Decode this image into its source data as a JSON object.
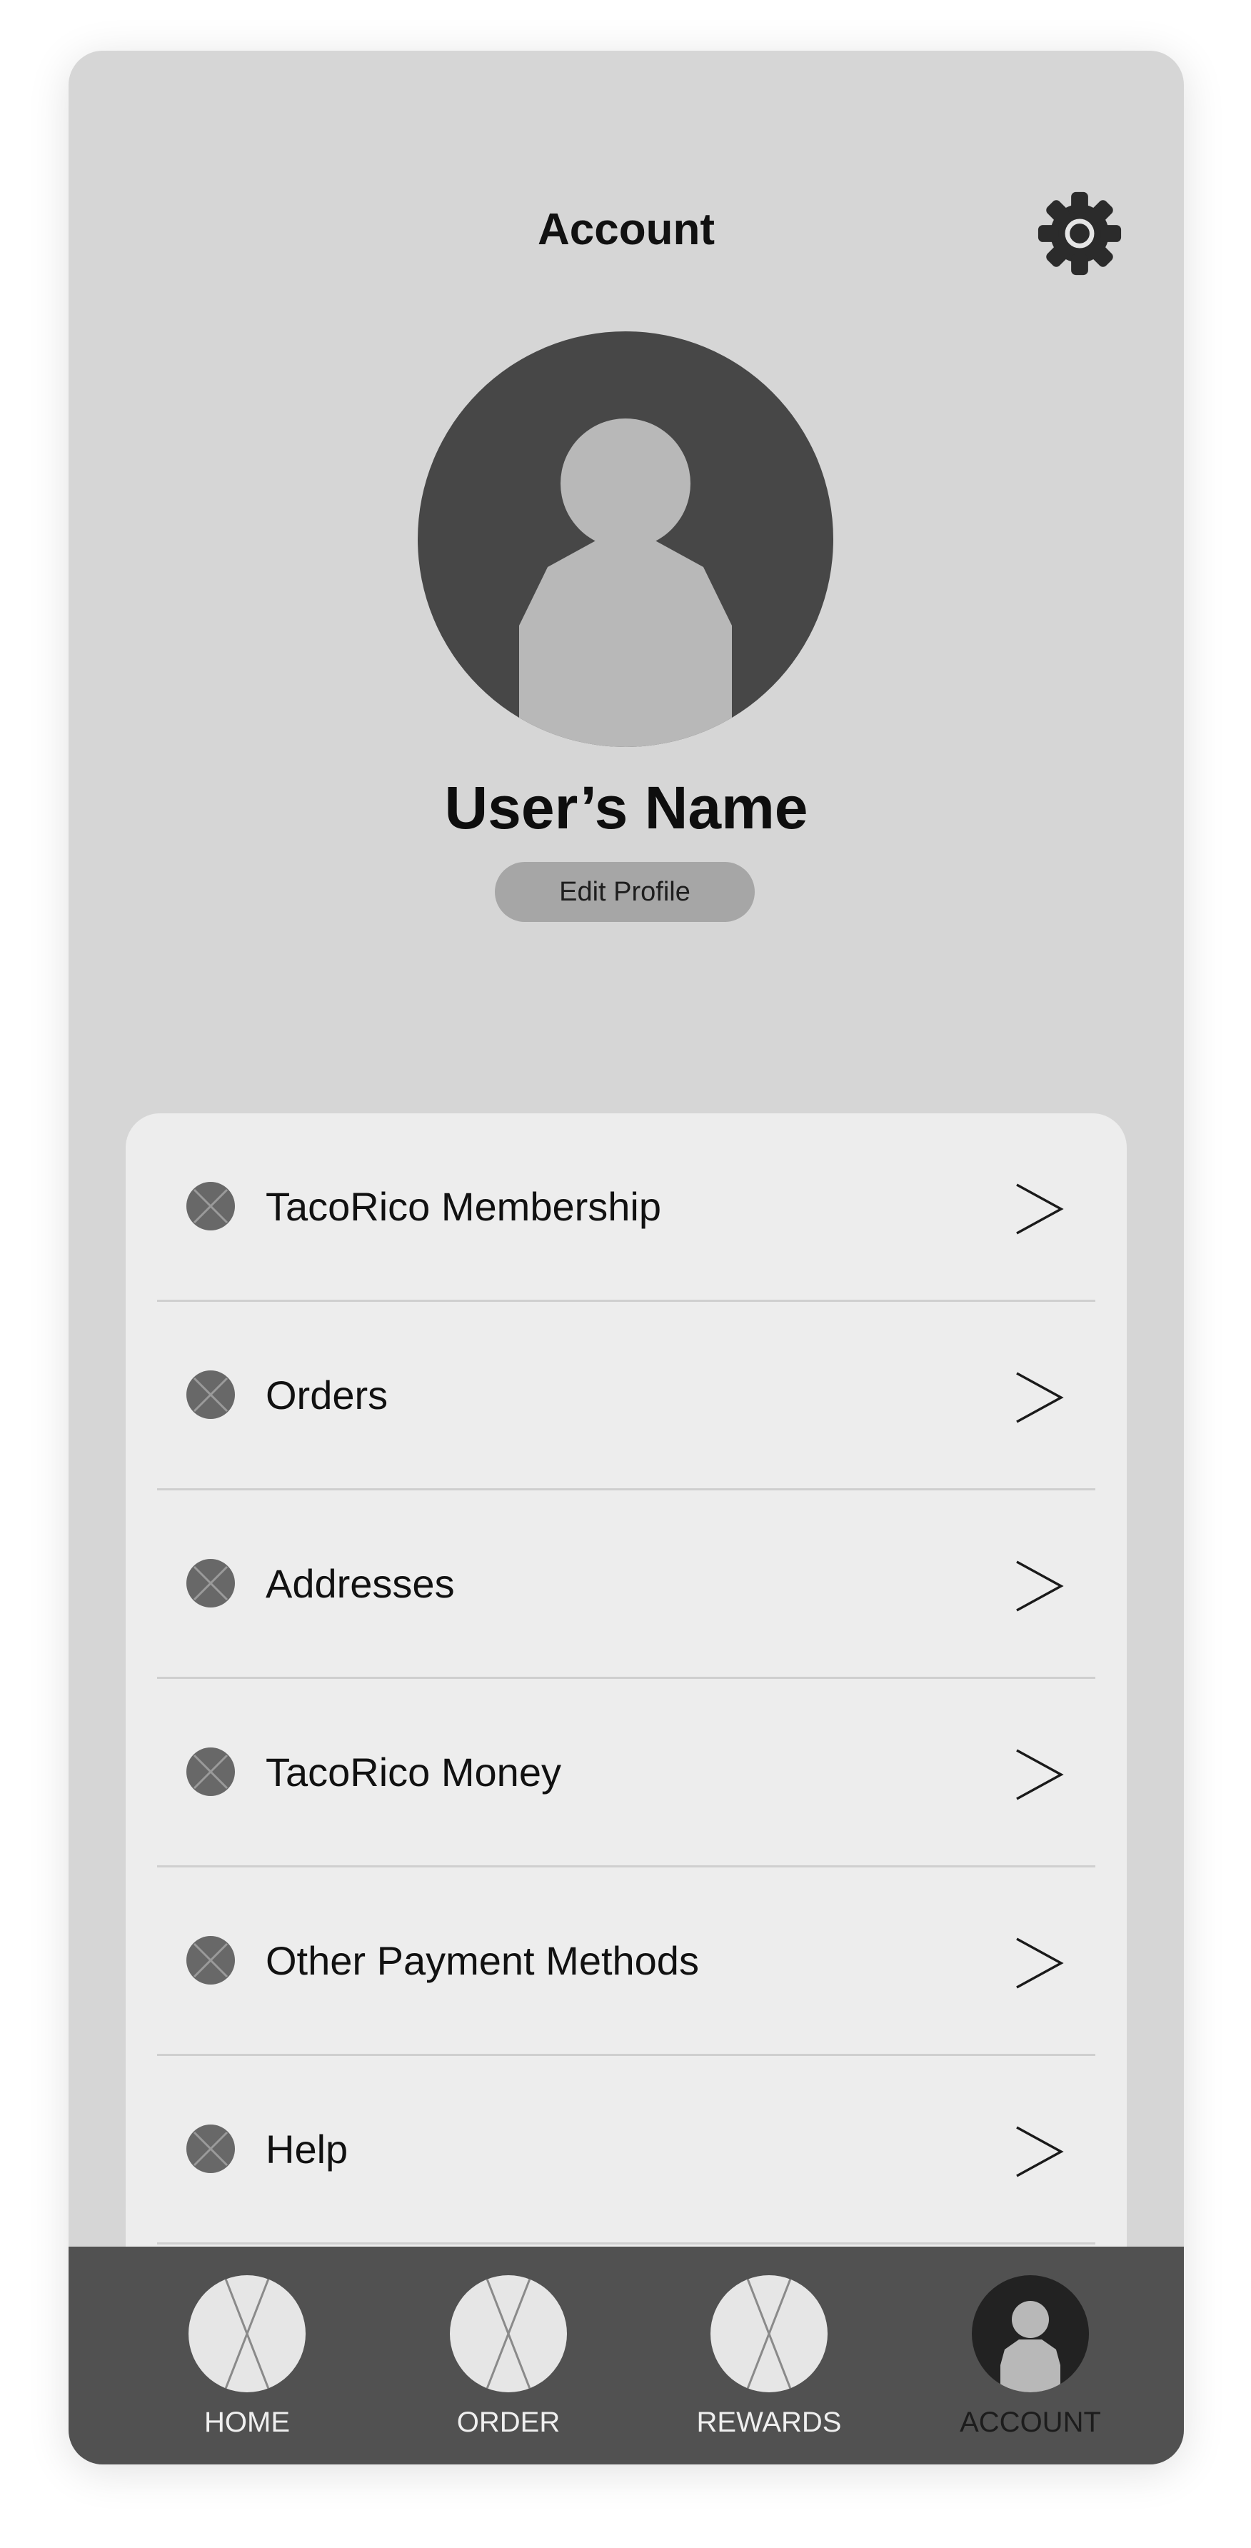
{
  "header": {
    "title": "Account",
    "settings_icon": "gear-icon"
  },
  "profile": {
    "avatar_icon": "user-avatar-icon",
    "name": "User’s Name",
    "edit_label": "Edit Profile"
  },
  "menu": {
    "items": [
      {
        "label": "TacoRico Membership",
        "icon": "placeholder-icon"
      },
      {
        "label": "Orders",
        "icon": "placeholder-icon"
      },
      {
        "label": "Addresses",
        "icon": "placeholder-icon"
      },
      {
        "label": "TacoRico Money",
        "icon": "placeholder-icon"
      },
      {
        "label": "Other Payment Methods",
        "icon": "placeholder-icon"
      },
      {
        "label": "Help",
        "icon": "placeholder-icon"
      }
    ],
    "chevron_icon": "chevron-right-icon"
  },
  "nav": {
    "items": [
      {
        "label": "HOME",
        "icon": "placeholder-icon",
        "active": false
      },
      {
        "label": "ORDER",
        "icon": "placeholder-icon",
        "active": false
      },
      {
        "label": "REWARDS",
        "icon": "placeholder-icon",
        "active": false
      },
      {
        "label": "ACCOUNT",
        "icon": "user-icon",
        "active": true
      }
    ]
  },
  "colors": {
    "screen_bg": "#d6d6d6",
    "card_bg": "#ededed",
    "nav_bg": "#515151",
    "avatar_bg": "#474747",
    "avatar_figure": "#b8b8b8",
    "button_bg": "#a6a6a6"
  }
}
